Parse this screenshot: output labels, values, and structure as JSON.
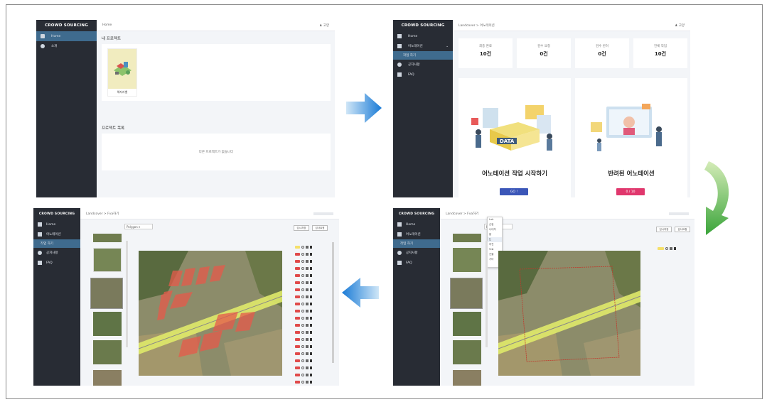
{
  "colors": {
    "sidebar": "#282c34",
    "active": "#3f6b8e",
    "go_button": "#3b56b8",
    "reject_button": "#e0376d",
    "arrow_blue": "#1a7bd6",
    "arrow_green": "#3aa43a",
    "aerial_field": "#8c8c6a",
    "annotation_fill": "#e65a4a",
    "road_highlight": "#dfe96a"
  },
  "brand": "CROWD SOURCING",
  "user_label": "고양",
  "screen1": {
    "breadcrumb": "Home",
    "nav": [
      {
        "label": "Home",
        "icon": "home-icon"
      },
      {
        "label": "소개",
        "icon": "info-icon"
      }
    ],
    "section1": "내 프로젝트",
    "project_name": "해지라벨",
    "section2": "프로젝트 목록",
    "empty": "다른 프로젝트가 없습니다"
  },
  "screen2": {
    "breadcrumb": "Landcover > 어노테이션",
    "nav": [
      {
        "label": "Home",
        "icon": "home-icon"
      },
      {
        "label": "어노테이션",
        "icon": "edit-icon"
      },
      {
        "label": "작업 하기",
        "icon": ""
      },
      {
        "label": "공지사항",
        "icon": "info-icon"
      },
      {
        "label": "FAQ",
        "icon": "faq-icon"
      }
    ],
    "stats": [
      {
        "label": "최종 완료",
        "value": "10건"
      },
      {
        "label": "검수 요청",
        "value": "0건"
      },
      {
        "label": "검수 반려",
        "value": "0건"
      },
      {
        "label": "전체 작업",
        "value": "10건"
      }
    ],
    "panel1": {
      "title": "어노테이션 작업 시작하기",
      "badge": "DATA",
      "button": "GO !"
    },
    "panel2": {
      "title": "반려된 어노테이션",
      "button": "0 / 10"
    }
  },
  "screen3": {
    "breadcrumb": "Landcover > Fva하기",
    "nav": [
      {
        "label": "Home",
        "icon": "home-icon"
      },
      {
        "label": "어노테이션",
        "icon": "edit-icon"
      },
      {
        "label": "작업 하기",
        "icon": ""
      },
      {
        "label": "공지사항",
        "icon": "info-icon"
      },
      {
        "label": "FAQ",
        "icon": "faq-icon"
      }
    ],
    "tool_label": "Polygon",
    "btn_save": "임시저장",
    "btn_submit": "검사요청"
  },
  "screen4": {
    "breadcrumb": "Landcover > Fva하기",
    "tool_label": "Polygon",
    "btn_save": "임시저장",
    "btn_submit": "검사요청",
    "dropdown": [
      "Lab",
      "산림",
      "나대지",
      "밭",
      "논",
      "하천",
      "도로",
      "건물",
      "기타"
    ]
  }
}
